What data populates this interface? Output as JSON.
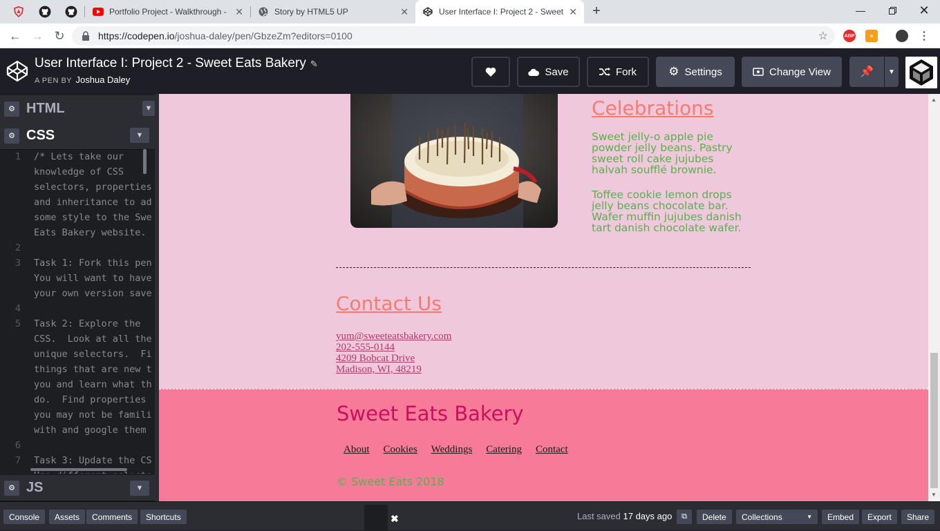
{
  "browser": {
    "tabs": [
      {
        "title": "Portfolio Project - Walkthrough -",
        "icon": "youtube-icon"
      },
      {
        "title": "Story by HTML5 UP",
        "icon": "globe-icon"
      },
      {
        "title": "User Interface I: Project 2 - Sweet",
        "icon": "codepen-icon",
        "active": true
      }
    ],
    "url_host": "https://codepen.io",
    "url_path": "/joshua-daley/pen/GbzeZm?editors=0100",
    "extensions": [
      "ABP"
    ]
  },
  "header": {
    "title": "User Interface I: Project 2 - Sweet Eats Bakery",
    "pen_by": "A PEN BY",
    "author": "Joshua Daley",
    "buttons": {
      "save": "Save",
      "fork": "Fork",
      "settings": "Settings",
      "change_view": "Change View"
    }
  },
  "editor": {
    "panels": [
      "HTML",
      "CSS",
      "JS"
    ],
    "code_lines": [
      {
        "n": "1",
        "t": "/* Lets take our"
      },
      {
        "n": "",
        "t": "knowledge of CSS"
      },
      {
        "n": "",
        "t": "selectors, properties"
      },
      {
        "n": "",
        "t": "and inheritance to ad"
      },
      {
        "n": "",
        "t": "some style to the Swe"
      },
      {
        "n": "",
        "t": "Eats Bakery website."
      },
      {
        "n": "2",
        "t": ""
      },
      {
        "n": "3",
        "t": "Task 1: Fork this pen"
      },
      {
        "n": "",
        "t": "You will want to have"
      },
      {
        "n": "",
        "t": "your own version save"
      },
      {
        "n": "4",
        "t": ""
      },
      {
        "n": "5",
        "t": "Task 2: Explore the"
      },
      {
        "n": "",
        "t": "CSS.  Look at all the"
      },
      {
        "n": "",
        "t": "unique selectors.  Fi"
      },
      {
        "n": "",
        "t": "things that are new t"
      },
      {
        "n": "",
        "t": "you and learn what th"
      },
      {
        "n": "",
        "t": "do.  Find properties"
      },
      {
        "n": "",
        "t": "you may not be famili"
      },
      {
        "n": "",
        "t": "with and google them"
      },
      {
        "n": "6",
        "t": ""
      },
      {
        "n": "7",
        "t": "Task 3: Update the CS"
      },
      {
        "n": "",
        "t": "Use different selecto"
      }
    ]
  },
  "preview": {
    "celebrations_heading": "Celebrations",
    "celebrations_p1": "Sweet jelly-o apple pie powder jelly beans. Pastry sweet roll cake jujubes halvah soufflé brownie.",
    "celebrations_p2": "Toffee cookie lemon drops jelly beans chocolate bar. Wafer muffin jujubes danish tart danish chocolate wafer.",
    "contact_heading": "Contact Us",
    "contact": {
      "email": "yum@sweeteatsbakery.com",
      "phone": "202-555-0144",
      "street": "4209 Bobcat Drive",
      "city": "Madison, WI, 48219"
    },
    "footer": {
      "brand": "Sweet Eats Bakery",
      "nav": [
        "About",
        "Cookies",
        "Weddings",
        "Catering",
        "Contact"
      ],
      "copyright": "© Sweet Eats 2018"
    }
  },
  "bottombar": {
    "left": [
      "Console",
      "Assets",
      "Comments",
      "Shortcuts"
    ],
    "last_saved_prefix": "Last saved",
    "last_saved_value": "17 days ago",
    "right": [
      "Delete",
      "Collections",
      "Embed",
      "Export",
      "Share"
    ]
  }
}
